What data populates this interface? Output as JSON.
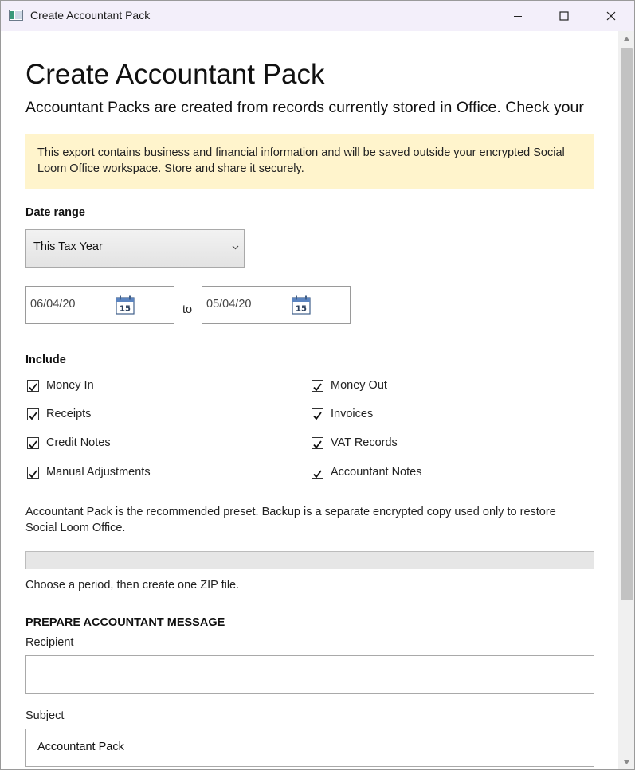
{
  "window": {
    "title": "Create Accountant Pack",
    "controls": {
      "minimize": "minimize-icon",
      "maximize": "maximize-icon",
      "close": "close-icon"
    }
  },
  "page": {
    "title": "Create Accountant Pack",
    "subtitle": "Accountant Packs are created from records currently stored in Office. Check your"
  },
  "warning": {
    "line1": "This export contains business and financial information and will be saved outside your encrypted Social",
    "line2": "Loom Office workspace. Store and share it securely."
  },
  "date_range": {
    "label": "Date range",
    "selected": "This Tax Year",
    "from": "06/04/20",
    "to_label": "to",
    "to": "05/04/20",
    "calendar_icon_text": "15"
  },
  "include": {
    "label": "Include",
    "items": [
      {
        "label": "Money In",
        "checked": true
      },
      {
        "label": "Money Out",
        "checked": true
      },
      {
        "label": "Receipts",
        "checked": true
      },
      {
        "label": "Invoices",
        "checked": true
      },
      {
        "label": "Credit Notes",
        "checked": true
      },
      {
        "label": "VAT Records",
        "checked": true
      },
      {
        "label": "Manual Adjustments",
        "checked": true
      },
      {
        "label": "Accountant Notes",
        "checked": true
      }
    ]
  },
  "info": {
    "line1": "Accountant Pack is the recommended preset. Backup is a separate encrypted copy used only to restore",
    "line2": "Social Loom Office."
  },
  "progress": {
    "value": 0
  },
  "status": "Choose a period, then create one ZIP file.",
  "message": {
    "heading": "PREPARE ACCOUNTANT MESSAGE",
    "recipient_label": "Recipient",
    "recipient_value": "",
    "subject_label": "Subject",
    "subject_value": "Accountant Pack"
  },
  "colors": {
    "warning_bg": "#fff4cc",
    "titlebar_bg": "#f3effa",
    "progress_fill": "#06b025"
  }
}
